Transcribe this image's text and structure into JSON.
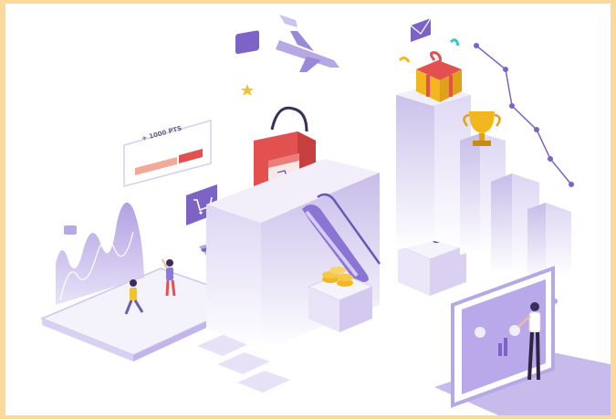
{
  "illustration": {
    "points_badge_text": "+ 1000 PTS",
    "palette": {
      "border": "#fbd99a",
      "purple": "#8b6fd1",
      "lavender": "#d9cff2",
      "light_lavender": "#eeeaf9",
      "red": "#e2514f",
      "gold": "#f2b71f",
      "cyan": "#35c3d9"
    },
    "icons": [
      "airplane-icon",
      "chat-star-icon",
      "mail-icon",
      "shopping-bag-icon",
      "cart-icon",
      "credit-card-icon",
      "percent-icon",
      "gift-box-icon",
      "trophy-icon",
      "coin-stack-icon",
      "escalator-icon",
      "line-chart-icon"
    ]
  }
}
